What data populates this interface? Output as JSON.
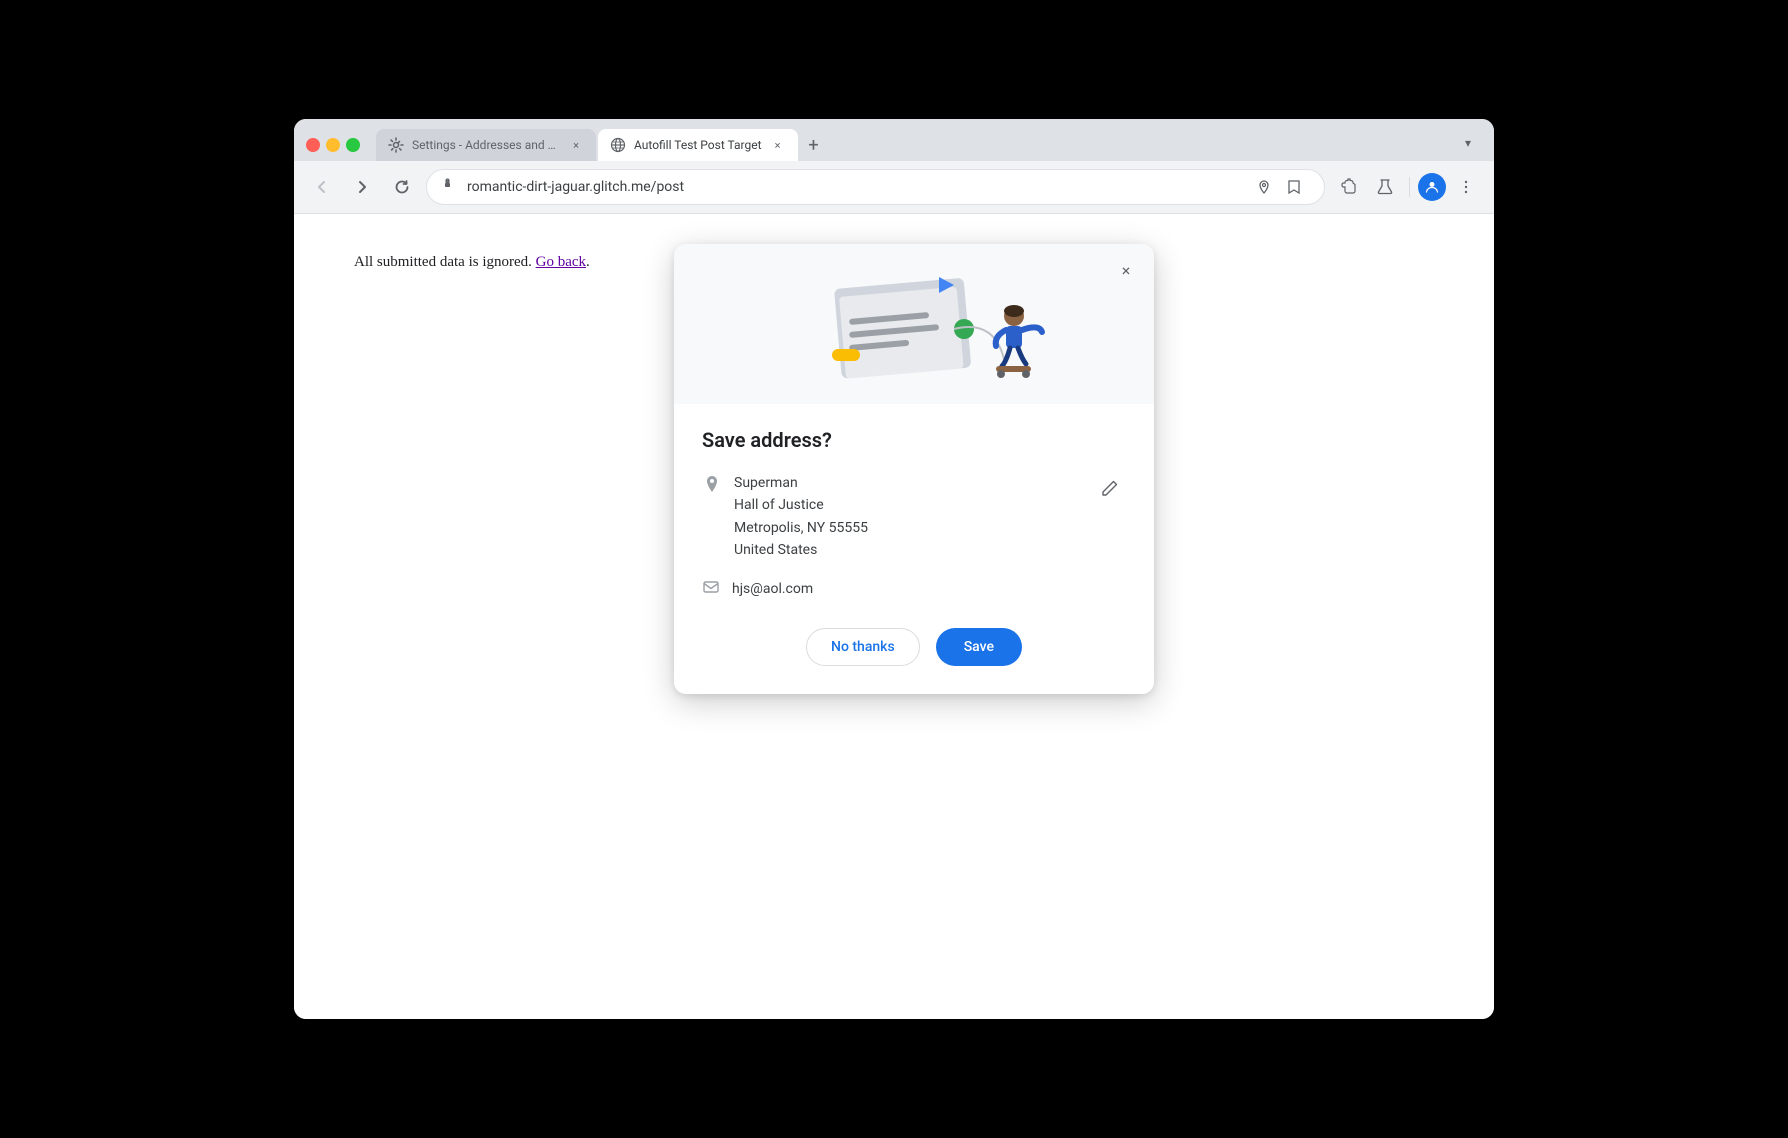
{
  "browser": {
    "tabs": [
      {
        "id": "settings-tab",
        "title": "Settings - Addresses and mo",
        "icon_type": "gear",
        "active": false
      },
      {
        "id": "autofill-tab",
        "title": "Autofill Test Post Target",
        "icon_type": "globe",
        "active": true
      }
    ],
    "new_tab_label": "+",
    "dropdown_label": "▾",
    "url": "romantic-dirt-jaguar.glitch.me/post",
    "nav": {
      "back": "←",
      "forward": "→",
      "refresh": "↻"
    }
  },
  "page": {
    "content_text": "All submitted data is ignored.",
    "go_back_link": "Go back",
    "period": "."
  },
  "popup": {
    "title": "Save address?",
    "close_label": "×",
    "address": {
      "name": "Superman",
      "street": "Hall of Justice",
      "city_state_zip": "Metropolis, NY 55555",
      "country": "United States"
    },
    "email": "hjs@aol.com",
    "buttons": {
      "no_thanks": "No thanks",
      "save": "Save"
    }
  }
}
